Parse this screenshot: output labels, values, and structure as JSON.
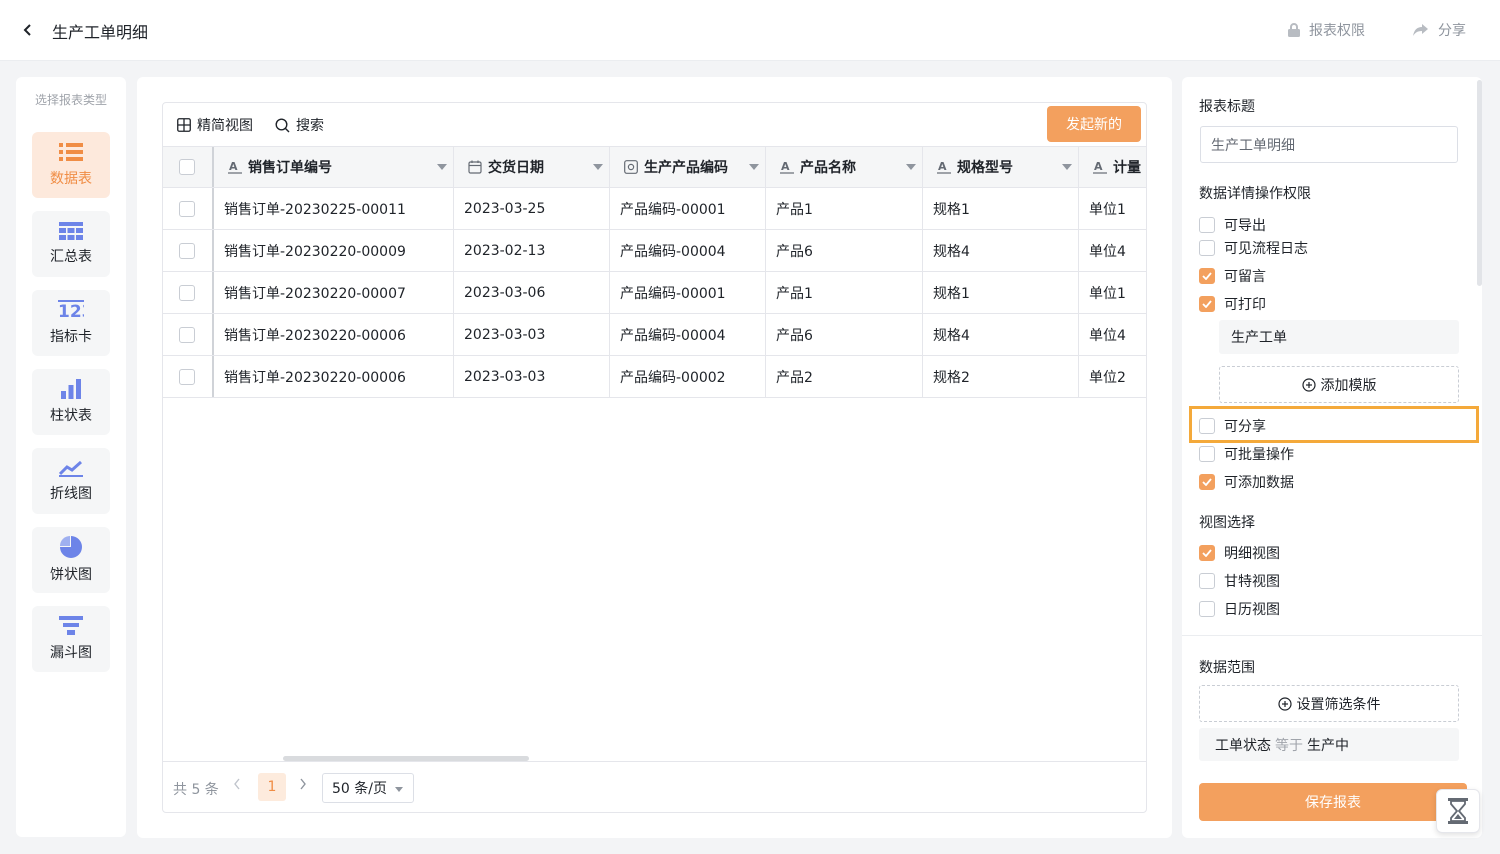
{
  "header": {
    "title": "生产工单明细",
    "permission_label": "报表权限",
    "share_label": "分享"
  },
  "typebar": {
    "title": "选择报表类型",
    "items": [
      {
        "label": "数据表",
        "icon": "list-icon",
        "active": true
      },
      {
        "label": "汇总表",
        "icon": "table-grid-icon",
        "active": false
      },
      {
        "label": "指标卡",
        "icon": "number-card-icon",
        "active": false
      },
      {
        "label": "柱状表",
        "icon": "bar-chart-icon",
        "active": false
      },
      {
        "label": "折线图",
        "icon": "line-chart-icon",
        "active": false
      },
      {
        "label": "饼状图",
        "icon": "pie-chart-icon",
        "active": false
      },
      {
        "label": "漏斗图",
        "icon": "funnel-icon",
        "active": false
      }
    ]
  },
  "toolbar": {
    "simple_view_label": "精简视图",
    "search_label": "搜索",
    "new_button_label": "发起新的"
  },
  "table": {
    "columns": [
      {
        "label": "销售订单编号",
        "icon": "text-field-icon"
      },
      {
        "label": "交货日期",
        "icon": "calendar-icon"
      },
      {
        "label": "生产产品编码",
        "icon": "code-field-icon"
      },
      {
        "label": "产品名称",
        "icon": "text-field-icon"
      },
      {
        "label": "规格型号",
        "icon": "text-field-icon"
      },
      {
        "label": "计量",
        "icon": "text-field-icon"
      }
    ],
    "rows": [
      [
        "销售订单-20230225-00011",
        "2023-03-25",
        "产品编码-00001",
        "产品1",
        "规格1",
        "单位1"
      ],
      [
        "销售订单-20230220-00009",
        "2023-02-13",
        "产品编码-00004",
        "产品6",
        "规格4",
        "单位4"
      ],
      [
        "销售订单-20230220-00007",
        "2023-03-06",
        "产品编码-00001",
        "产品1",
        "规格1",
        "单位1"
      ],
      [
        "销售订单-20230220-00006",
        "2023-03-03",
        "产品编码-00004",
        "产品6",
        "规格4",
        "单位4"
      ],
      [
        "销售订单-20230220-00006",
        "2023-03-03",
        "产品编码-00002",
        "产品2",
        "规格2",
        "单位2"
      ]
    ]
  },
  "pagination": {
    "total": "共 5 条",
    "current_page": "1",
    "page_size": "50 条/页"
  },
  "settings": {
    "report_title_label": "报表标题",
    "report_title_value": "生产工单明细",
    "permissions_label": "数据详情操作权限",
    "permissions": [
      {
        "label": "可导出",
        "checked": false
      },
      {
        "label": "可见流程日志",
        "checked": false
      },
      {
        "label": "可留言",
        "checked": true
      },
      {
        "label": "可打印",
        "checked": true
      },
      {
        "label": "可分享",
        "checked": false
      },
      {
        "label": "可批量操作",
        "checked": false
      },
      {
        "label": "可添加数据",
        "checked": true
      }
    ],
    "print_template": "生产工单",
    "add_template_label": "添加模版",
    "view_label": "视图选择",
    "views": [
      {
        "label": "明细视图",
        "checked": true
      },
      {
        "label": "甘特视图",
        "checked": false
      },
      {
        "label": "日历视图",
        "checked": false
      }
    ],
    "data_range_label": "数据范围",
    "filter_button_label": "设置筛选条件",
    "condition": {
      "field": "工单状态",
      "operator": "等于",
      "value": "生产中"
    },
    "save_label": "保存报表"
  },
  "colors": {
    "accent": "#f3a05e",
    "highlight_border": "#f4a93a",
    "active_type_bg": "#fde9dc"
  }
}
